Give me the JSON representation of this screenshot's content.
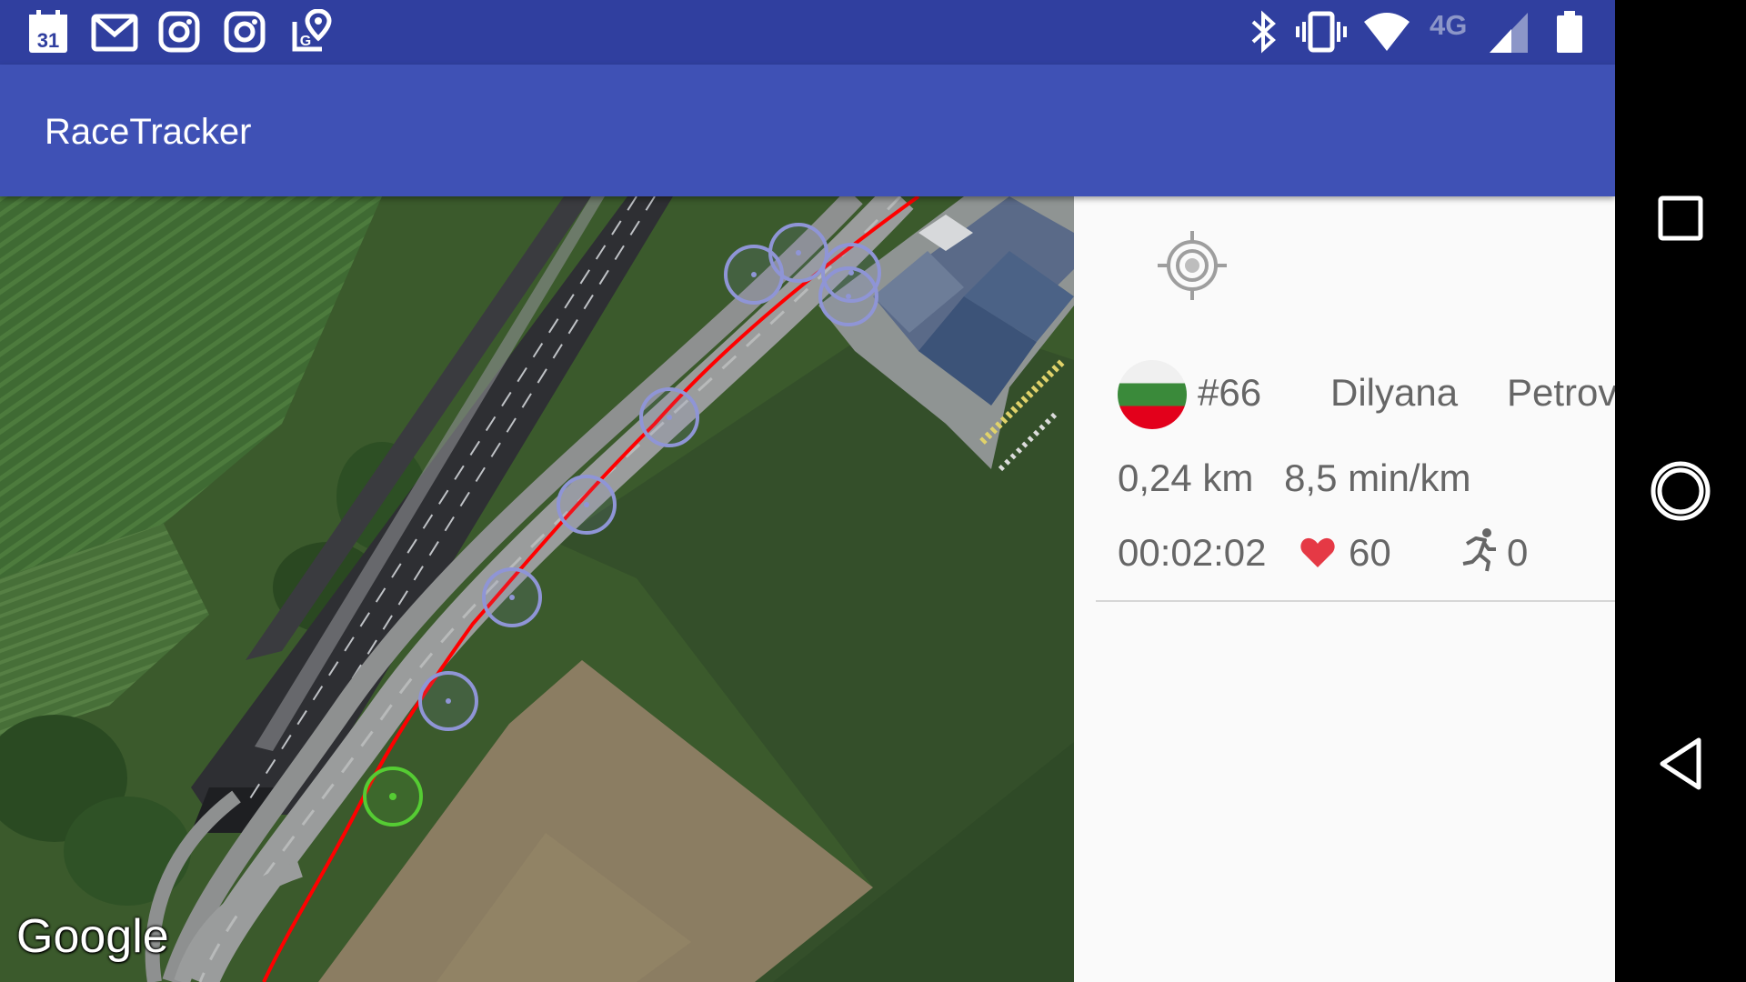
{
  "status_bar": {
    "left_icons": [
      "calendar-icon",
      "gmail-icon",
      "instagram-icon",
      "instagram-icon",
      "maps-icon"
    ],
    "calendar_day": "31",
    "right_icons": [
      "bluetooth-icon",
      "vibrate-icon",
      "wifi-icon",
      "signal-icon",
      "battery-icon"
    ],
    "network_label": "4G"
  },
  "app_bar": {
    "title": "RaceTracker"
  },
  "map": {
    "attribution": "Google",
    "route_color": "#ff0000",
    "marker_color": "#8f95d6",
    "current_marker_color": "#55cc33"
  },
  "panel": {
    "locate_icon": "my-location-icon",
    "flag_icon": "bulgaria-flag-icon",
    "bib": "#66",
    "first_name": "Dilyana",
    "last_name": "Petrova",
    "distance": "0,24 km",
    "pace": "8,5 min/km",
    "elapsed": "00:02:02",
    "heart_rate": "60",
    "heart_color": "#e53945",
    "steps": "0"
  },
  "nav_bar": {
    "buttons": [
      "recents-button",
      "home-button",
      "back-button"
    ]
  }
}
